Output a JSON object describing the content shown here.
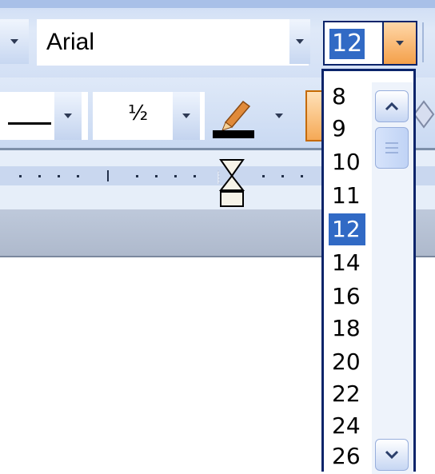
{
  "font_toolbar": {
    "font_name": "Arial",
    "font_size": "12",
    "colors": {
      "selection_bg": "#316ac5",
      "hot_button": "#f4a04a",
      "frame": "#0a246a"
    }
  },
  "line_toolbar": {
    "line_weight_value": "½",
    "icons": [
      "line-style-icon",
      "pen-color-icon",
      "chevron-down-icon"
    ]
  },
  "font_size_list": {
    "items": [
      "8",
      "9",
      "10",
      "11",
      "12",
      "14",
      "16",
      "18",
      "20",
      "22",
      "24",
      "26"
    ],
    "selected": "12",
    "scroll_icons": [
      "scroll-up-icon",
      "scroll-down-icon",
      "scroll-thumb-grip-icon"
    ]
  }
}
